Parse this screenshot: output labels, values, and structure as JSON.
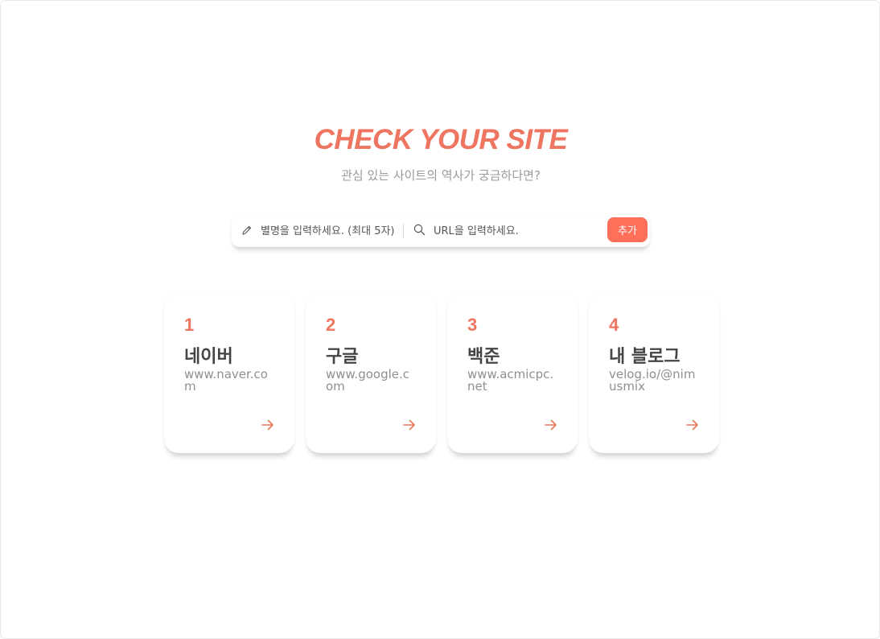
{
  "hero": {
    "title": "CHECK YOUR SITE",
    "subtitle": "관심 있는 사이트의 역사가 궁금하다면?"
  },
  "search": {
    "nickname_placeholder": "별명을 입력하세요. (최대 5자)",
    "nickname_icon": "pencil-icon",
    "url_placeholder": "URL을 입력하세요.",
    "url_icon": "search-icon",
    "add_label": "추가"
  },
  "colors": {
    "accent": "#ee7560",
    "button": "#ff6f5a",
    "name_text": "#444444",
    "muted_text": "#8f8f8f"
  },
  "cards": [
    {
      "num": "1",
      "name": "네이버",
      "url": "www.naver.com",
      "icon": "arrow-right-icon"
    },
    {
      "num": "2",
      "name": "구글",
      "url": "www.google.com",
      "icon": "arrow-right-icon"
    },
    {
      "num": "3",
      "name": "백준",
      "url": "www.acmicpc.net",
      "icon": "arrow-right-icon"
    },
    {
      "num": "4",
      "name": "내 블로그",
      "url": "velog.io/@nimusmix",
      "icon": "arrow-right-icon"
    }
  ]
}
